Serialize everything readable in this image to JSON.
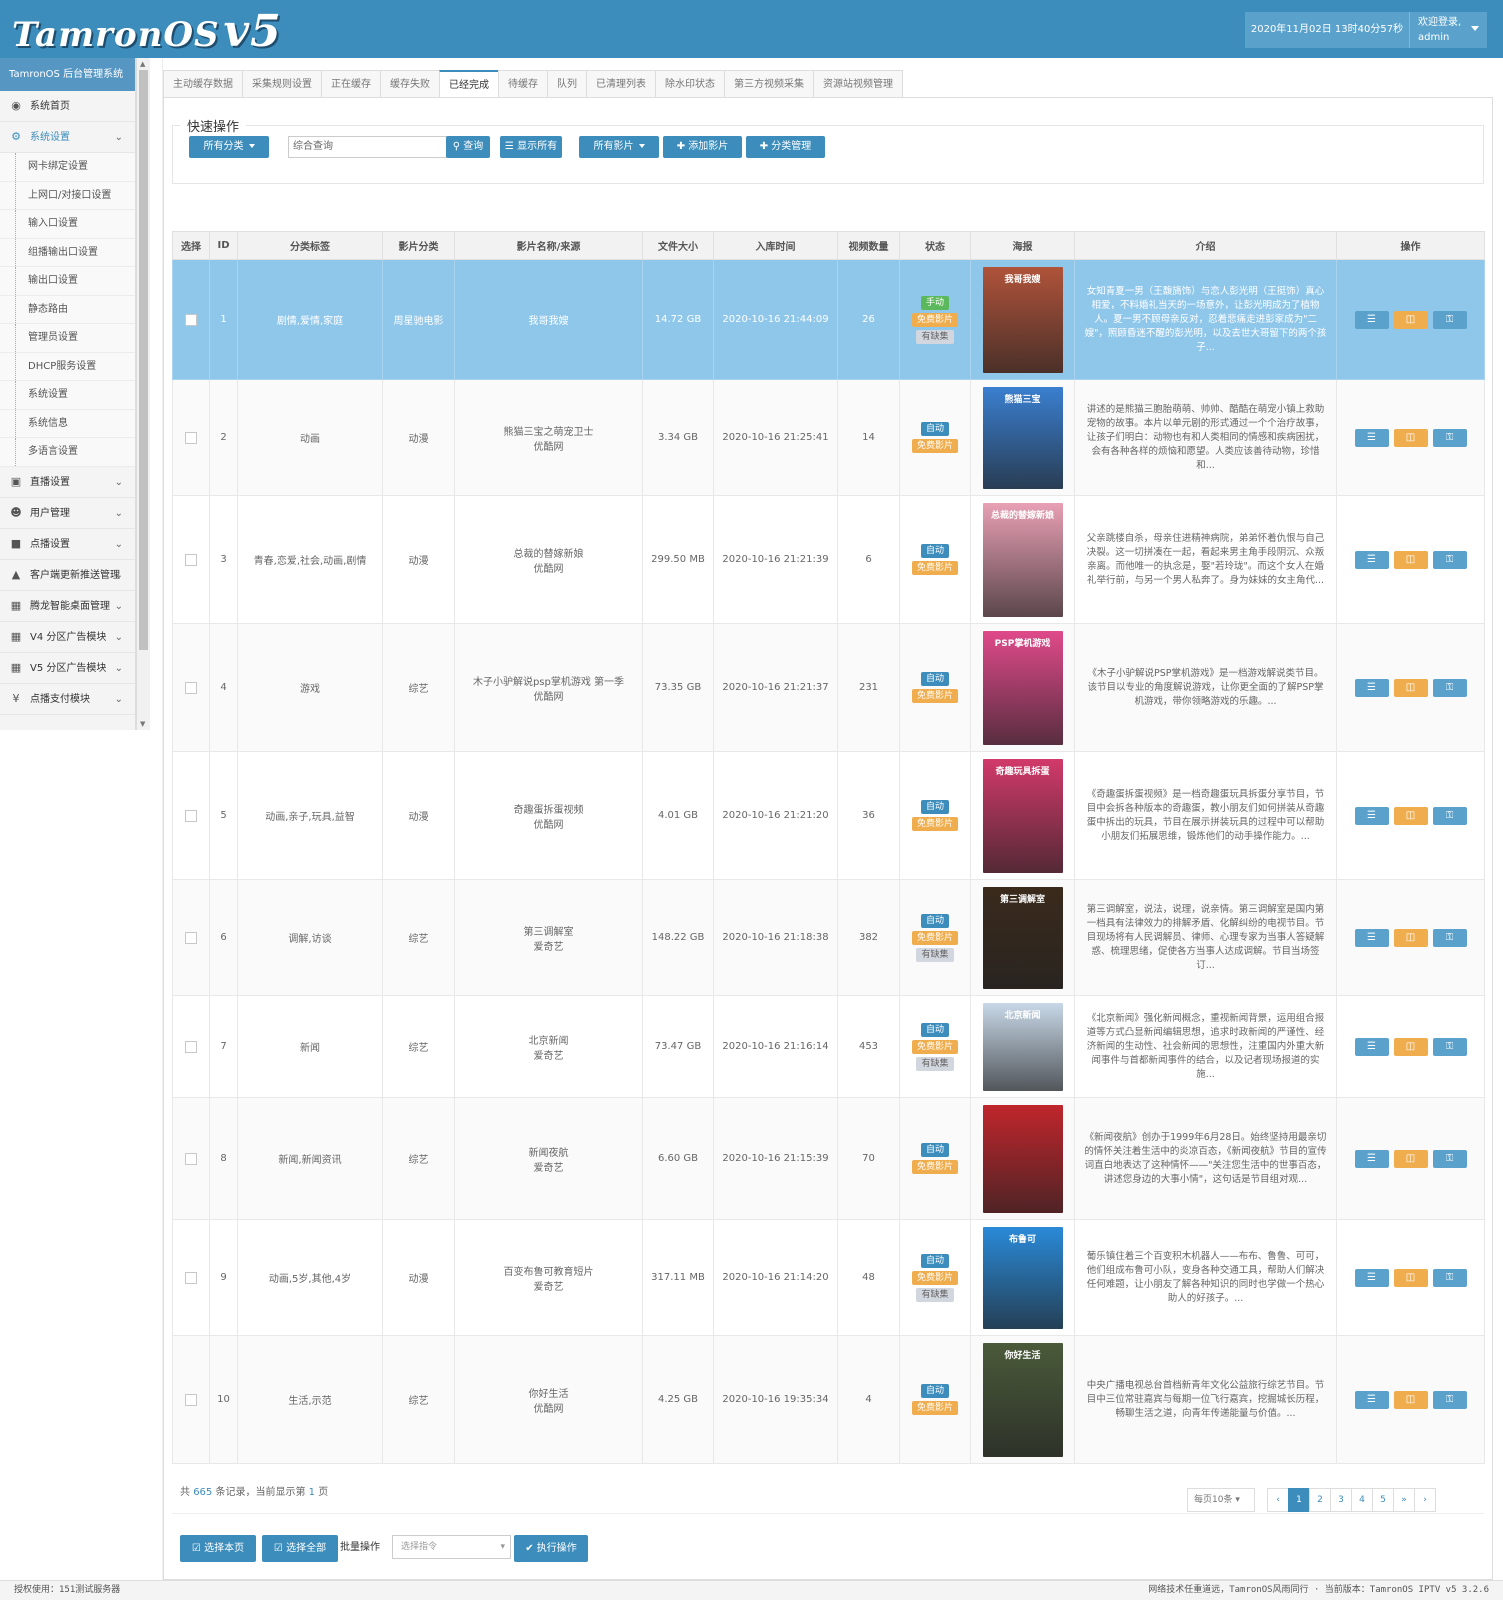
{
  "header": {
    "logo": "TamronOS",
    "version": "v5",
    "datetime": "2020年11月02日 13时40分57秒",
    "welcome": "欢迎登录,",
    "user": "admin"
  },
  "sidebar": {
    "title": "TamronOS 后台管理系统",
    "home": "系统首页",
    "system": "系统设置",
    "sub": [
      "网卡绑定设置",
      "上网口/对接口设置",
      "输入口设置",
      "组播输出口设置",
      "输出口设置",
      "静态路由",
      "管理员设置",
      "DHCP服务设置",
      "系统设置",
      "系统信息",
      "多语言设置"
    ],
    "menus": [
      {
        "label": "直播设置",
        "icon": "monitor-icon"
      },
      {
        "label": "用户管理",
        "icon": "user-icon"
      },
      {
        "label": "点播设置",
        "icon": "video-camera-icon"
      },
      {
        "label": "客户端更新推送管理",
        "icon": "android-icon"
      },
      {
        "label": "腾龙智能桌面管理",
        "icon": "windows-icon"
      },
      {
        "label": "V4 分区广告模块",
        "icon": "windows-icon"
      },
      {
        "label": "V5 分区广告模块",
        "icon": "windows-icon"
      },
      {
        "label": "点播支付模块",
        "icon": "yen-icon"
      }
    ]
  },
  "tabs": [
    "主动缓存数据",
    "采集规则设置",
    "正在缓存",
    "缓存失败",
    "已经完成",
    "待缓存",
    "队列",
    "已清理列表",
    "除水印状态",
    "第三方视频采集",
    "资源站视频管理"
  ],
  "active_tab": 4,
  "quick": {
    "title": "快速操作",
    "category": "所有分类",
    "search_placeholder": "综合查询",
    "query": "查询",
    "show_all": "显示所有",
    "all_movies": "所有影片",
    "add_movie": "添加影片",
    "cat_manage": "分类管理"
  },
  "columns": [
    "选择",
    "ID",
    "分类标签",
    "影片分类",
    "影片名称/来源",
    "文件大小",
    "入库时间",
    "视频数量",
    "状态",
    "海报",
    "介绍",
    "操作"
  ],
  "rows": [
    {
      "id": "1",
      "tags": "剧情,爱情,家庭",
      "cat": "周星驰电影",
      "name": "我哥我嫂",
      "source": "",
      "size": "14.72 GB",
      "time": "2020-10-16 21:44:09",
      "count": "26",
      "status": [
        "手动",
        "免费影片",
        "有缺集"
      ],
      "poster_text": "我哥我嫂",
      "poster_color": "#b0533a",
      "intro": "女知青夏一男（王馥旖饰）与恋人彭光明（王挺饰）真心相爱，不料婚礼当天的一场意外，让彭光明成为了植物人。夏一男不顾母亲反对，忍着悲痛走进彭家成为\"二嫂\"，照顾昏迷不醒的彭光明，以及去世大哥留下的两个孩子..."
    },
    {
      "id": "2",
      "tags": "动画",
      "cat": "动漫",
      "name": "熊猫三宝之萌宠卫士",
      "source": "优酷网",
      "size": "3.34 GB",
      "time": "2020-10-16 21:25:41",
      "count": "14",
      "status": [
        "自动",
        "免费影片"
      ],
      "poster_text": "熊猫三宝",
      "poster_color": "#3a7fd0",
      "intro": "讲述的是熊猫三胞胎萌萌、帅帅、酷酷在萌宠小镇上救助宠物的故事。本片以单元剧的形式通过一个个治疗故事，让孩子们明白：动物也有和人类相同的情感和疾病困扰，会有各种各样的烦恼和愿望。人类应该善待动物，珍惜和..."
    },
    {
      "id": "3",
      "tags": "青春,恋爱,社会,动画,剧情",
      "cat": "动漫",
      "name": "总裁的替嫁新娘",
      "source": "优酷网",
      "size": "299.50 MB",
      "time": "2020-10-16 21:21:39",
      "count": "6",
      "status": [
        "自动",
        "免费影片"
      ],
      "poster_text": "总裁的替嫁新娘",
      "poster_color": "#e8a0b4",
      "intro": "父亲跳楼自杀，母亲住进精神病院，弟弟怀着仇恨与自己决裂。这一切拼凑在一起，看起来男主角手段阴沉、众叛亲离。而他唯一的执念是，娶\"若玲珑\"。而这个女人在婚礼举行前，与另一个男人私奔了。身为妹妹的女主角代..."
    },
    {
      "id": "4",
      "tags": "游戏",
      "cat": "综艺",
      "name": "木子小驴解说psp掌机游戏 第一季",
      "source": "优酷网",
      "size": "73.35 GB",
      "time": "2020-10-16 21:21:37",
      "count": "231",
      "status": [
        "自动",
        "免费影片"
      ],
      "poster_text": "PSP掌机游戏",
      "poster_color": "#e04a8a",
      "intro": "《木子小驴解说PSP掌机游戏》是一档游戏解说类节目。该节目以专业的角度解说游戏，让你更全面的了解PSP掌机游戏，带你领略游戏的乐趣。..."
    },
    {
      "id": "5",
      "tags": "动画,亲子,玩具,益智",
      "cat": "动漫",
      "name": "奇趣蛋拆蛋视频",
      "source": "优酷网",
      "size": "4.01 GB",
      "time": "2020-10-16 21:21:20",
      "count": "36",
      "status": [
        "自动",
        "免费影片"
      ],
      "poster_text": "奇趣玩具拆蛋",
      "poster_color": "#d23a6a",
      "intro": "《奇趣蛋拆蛋视频》是一档奇趣蛋玩具拆蛋分享节目，节目中会拆各种版本的奇趣蛋，教小朋友们如何拼装从奇趣蛋中拆出的玩具，节目在展示拼装玩具的过程中可以帮助小朋友们拓展思维，锻炼他们的动手操作能力。..."
    },
    {
      "id": "6",
      "tags": "调解,访谈",
      "cat": "综艺",
      "name": "第三调解室",
      "source": "爱奇艺",
      "size": "148.22 GB",
      "time": "2020-10-16 21:18:38",
      "count": "382",
      "status": [
        "自动",
        "免费影片",
        "有缺集"
      ],
      "poster_text": "第三调解室",
      "poster_color": "#3a2a1c",
      "intro": "第三调解室，说法，说理，说亲情。第三调解室是国内第一档具有法律效力的排解矛盾、化解纠纷的电视节目。节目现场将有人民调解员、律师、心理专家为当事人答疑解惑、梳理思绪，促使各方当事人达成调解。节目当场签订..."
    },
    {
      "id": "7",
      "tags": "新闻",
      "cat": "综艺",
      "name": "北京新闻",
      "source": "爱奇艺",
      "size": "73.47 GB",
      "time": "2020-10-16 21:16:14",
      "count": "453",
      "status": [
        "自动",
        "免费影片",
        "有缺集"
      ],
      "poster_text": "北京新闻",
      "poster_color": "#c8d8e8",
      "intro": "《北京新闻》强化新闻概念，重视新闻背景，运用组合报道等方式凸显新闻编辑思想，追求时政新闻的严谨性、经济新闻的生动性、社会新闻的思想性，注重国内外重大新闻事件与首都新闻事件的结合，以及记者现场报道的实施..."
    },
    {
      "id": "8",
      "tags": "新闻,新闻资讯",
      "cat": "综艺",
      "name": "新闻夜航",
      "source": "爱奇艺",
      "size": "6.60 GB",
      "time": "2020-10-16 21:15:39",
      "count": "70",
      "status": [
        "自动",
        "免费影片"
      ],
      "poster_text": "",
      "poster_color": "#c0262c",
      "intro": "《新闻夜航》创办于1999年6月28日。始终坚持用最亲切的情怀关注着生活中的炎凉百态，《新闻夜航》节目的宣传词直白地表达了这种情怀——\"关注您生活中的世事百态，讲述您身边的大事小情\"，这句话是节目组对观..."
    },
    {
      "id": "9",
      "tags": "动画,5岁,其他,4岁",
      "cat": "动漫",
      "name": "百变布鲁可教育短片",
      "source": "爱奇艺",
      "size": "317.11 MB",
      "time": "2020-10-16 21:14:20",
      "count": "48",
      "status": [
        "自动",
        "免费影片",
        "有缺集"
      ],
      "poster_text": "布鲁可",
      "poster_color": "#2a8ad8",
      "intro": "葡乐镇住着三个百变积木机器人——布布、鲁鲁、可可，他们组成布鲁可小队，变身各种交通工具，帮助人们解决任何难题，让小朋友了解各种知识的同时也学做一个热心助人的好孩子。..."
    },
    {
      "id": "10",
      "tags": "生活,示范",
      "cat": "综艺",
      "name": "你好生活",
      "source": "优酷网",
      "size": "4.25 GB",
      "time": "2020-10-16 19:35:34",
      "count": "4",
      "status": [
        "自动",
        "免费影片"
      ],
      "poster_text": "你好生活",
      "poster_color": "#4a5a3a",
      "intro": "中央广播电视总台首档新青年文化公益旅行综艺节目。节目中三位常驻嘉宾与每期一位飞行嘉宾，挖掘城长历程，畅聊生活之道，向青年传递能量与价值。..."
    }
  ],
  "summary": {
    "prefix": "共",
    "total": "665",
    "mid": "条记录，当前显示第",
    "page": "1",
    "suffix": "页"
  },
  "pagesize": "每页10条",
  "pages": [
    "‹",
    "1",
    "2",
    "3",
    "4",
    "5",
    "»",
    "›"
  ],
  "batch": {
    "select_page": "选择本页",
    "select_all": "选择全部",
    "label": "批量操作",
    "placeholder": "选择指令",
    "execute": "执行操作"
  },
  "footer": {
    "left": "授权使用：151测试服务器",
    "right": "网络技术任重道远，TamronOS风雨同行 · 当前版本：TamronOS IPTV v5 3.2.6"
  },
  "colors": {
    "primary": "#3c8dbc",
    "selected_row": "#8fc7eb",
    "orange": "#f0ad4e",
    "green": "#5cb85c"
  }
}
